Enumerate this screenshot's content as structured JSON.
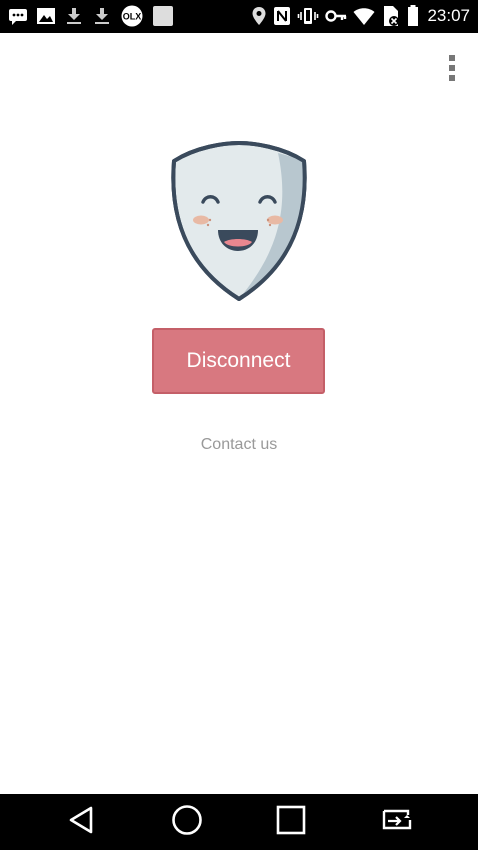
{
  "status_bar": {
    "time": "23:07",
    "left_icons": [
      "message-icon",
      "image-icon",
      "download-icon",
      "download-icon",
      "olx-icon",
      "blank-notification-icon"
    ],
    "right_icons": [
      "location-icon",
      "nfc-icon",
      "vibrate-icon",
      "key-icon",
      "wifi-icon",
      "no-sim-icon",
      "battery-icon"
    ],
    "olx_text": "OLX"
  },
  "toolbar": {
    "menu_icon": "more-vert-icon"
  },
  "main": {
    "mascot": "shield-mascot-icon",
    "disconnect_label": "Disconnect",
    "contact_label": "Contact us"
  },
  "colors": {
    "button_fill": "#d87880",
    "button_border": "#c45f68",
    "shield_fill": "#e3eaec",
    "shield_shade": "#b8c7cf",
    "shield_outline": "#3a4a5c",
    "contact_text": "#999999"
  },
  "nav_bar": {
    "buttons": [
      "back-icon",
      "home-icon",
      "recents-icon",
      "screen-rotate-icon"
    ]
  }
}
